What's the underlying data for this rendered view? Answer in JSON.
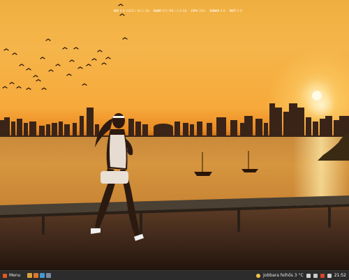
{
  "desktop": {
    "conky": [
      {
        "key": "HD",
        "value": "0 B USED / 93.1 GB"
      },
      {
        "key": "RAM",
        "value": "671 MB / 3.8 GB"
      },
      {
        "key": "CPU",
        "value": "16%"
      },
      {
        "key": "SWAP",
        "value": "0 B"
      },
      {
        "key": "NET",
        "value": "0 B"
      }
    ]
  },
  "taskbar": {
    "menu_label": "Menu",
    "weather_text": "Jobbara felhős 3 °C",
    "clock": "21:52",
    "launcher_icons": [
      "files-icon",
      "browser-icon",
      "terminal-icon",
      "app-icon"
    ],
    "tray_icons": [
      "network-icon",
      "volume-icon",
      "update-icon",
      "battery-icon"
    ]
  },
  "colors": {
    "taskbar_bg": "#2c2c2c",
    "menu_accent": "#e25822",
    "sky_top": "#f0b040",
    "sun": "#fffbe6"
  }
}
